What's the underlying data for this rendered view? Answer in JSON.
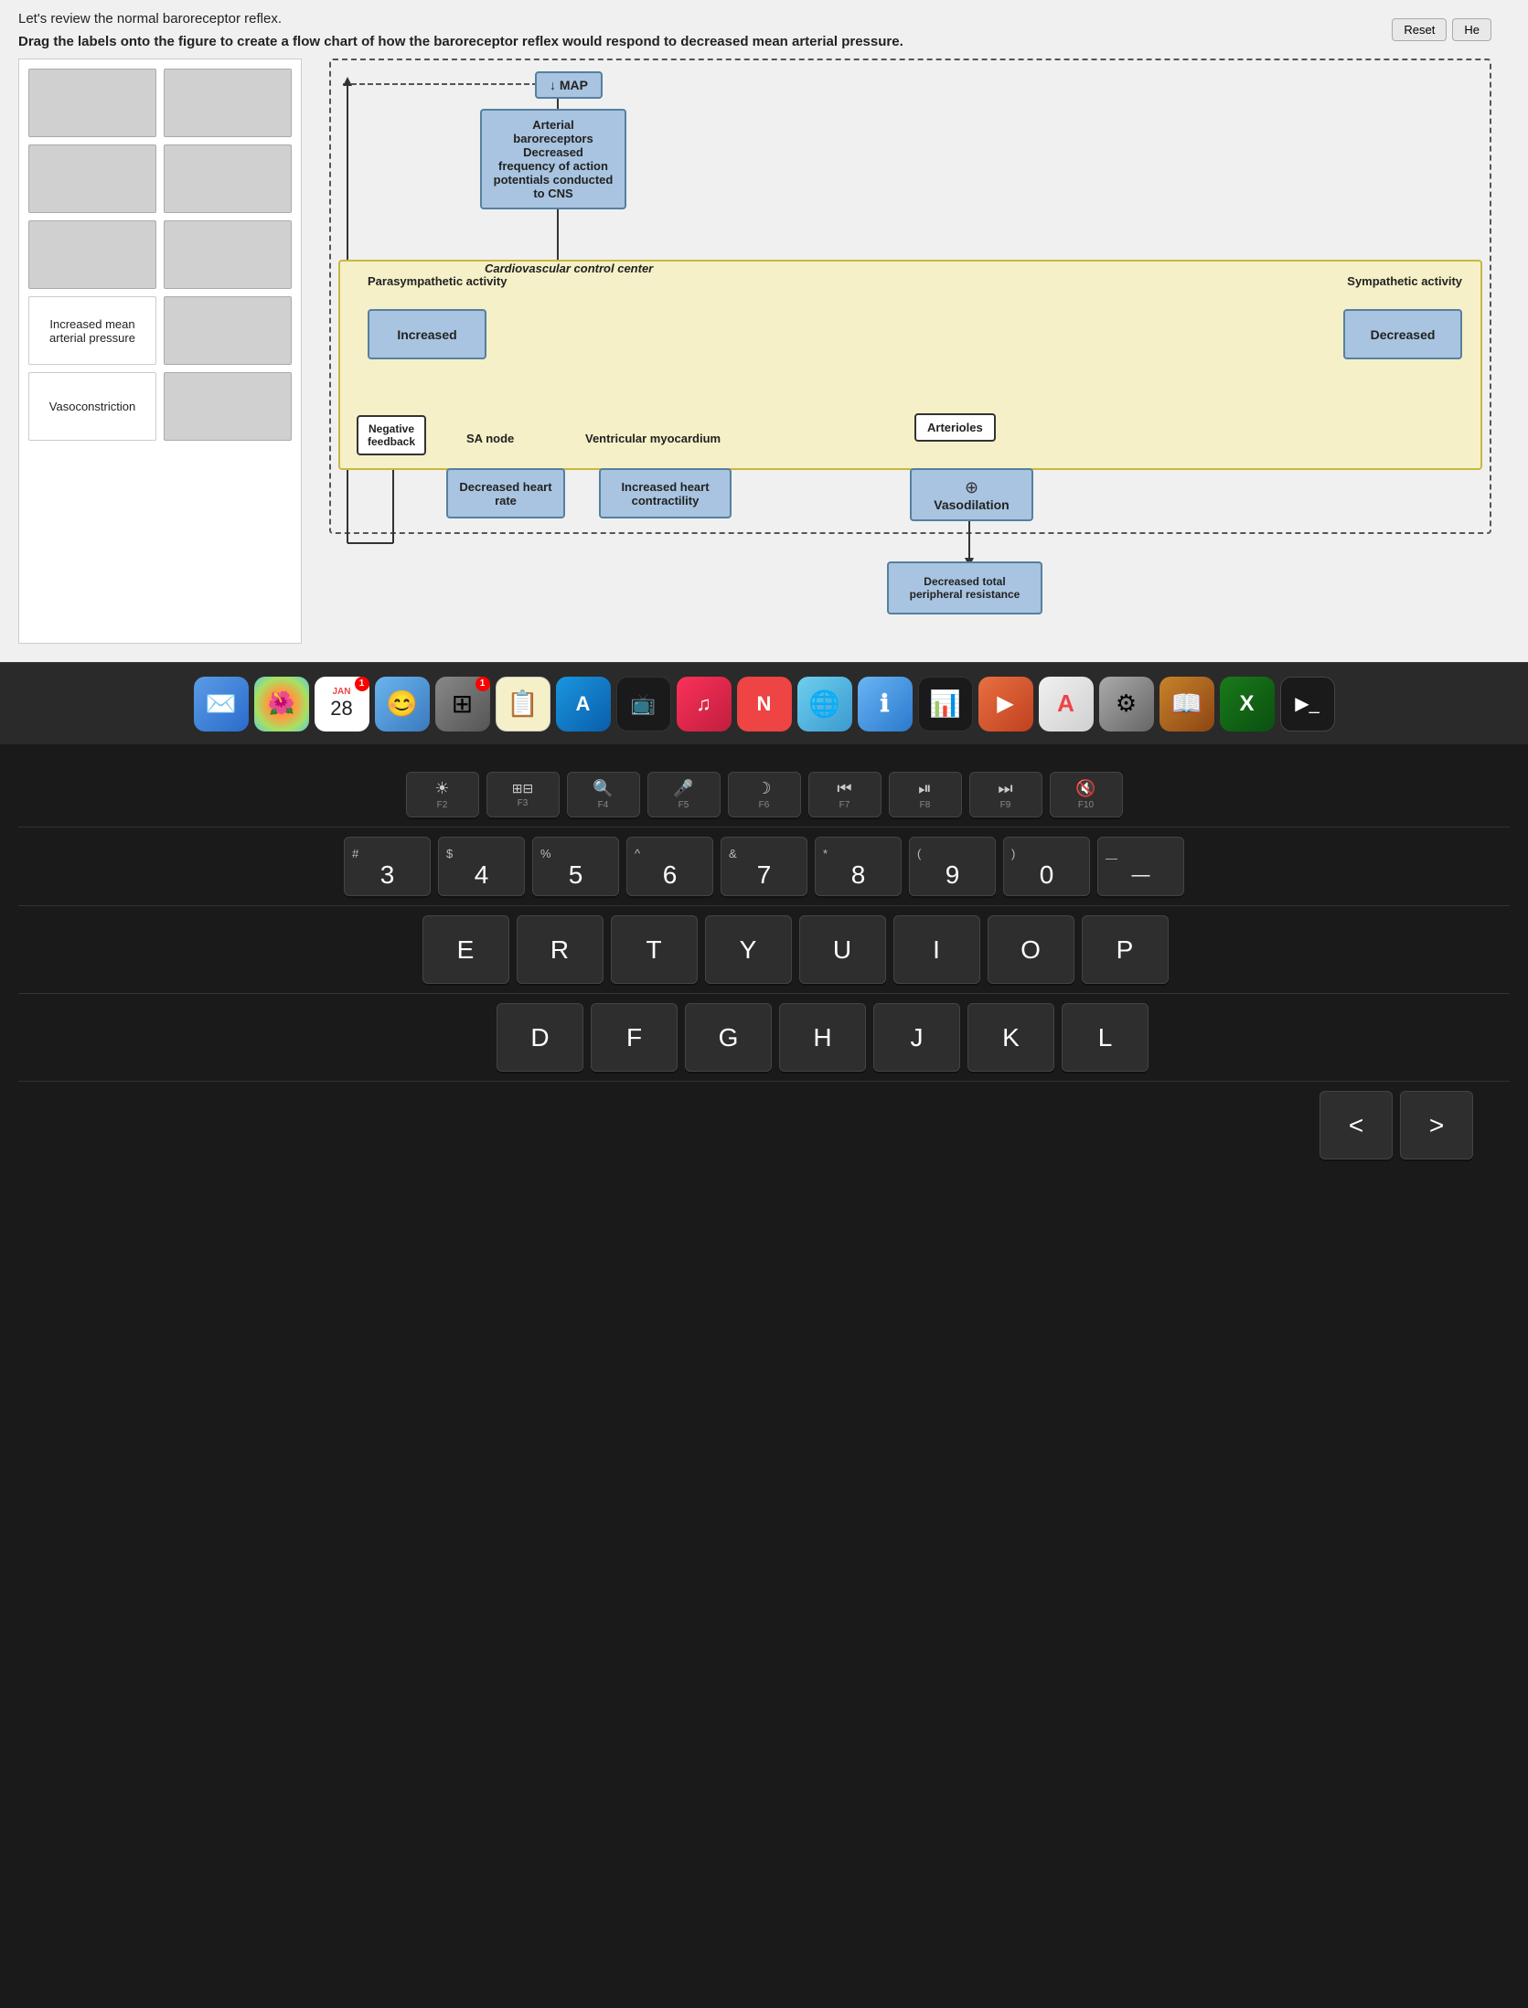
{
  "page": {
    "instruction1": "Let's review the normal baroreceptor reflex.",
    "instruction2": "Drag the labels onto the figure to create a flow chart of how the baroreceptor reflex would respond to decreased mean arterial pressure.",
    "reset_label": "Reset",
    "help_label": "He"
  },
  "flowchart": {
    "map_label": "↓ MAP",
    "arterial_box": "Arterial baroreceptors\nDecreased\nfrequency of action\npotentials conducted\nto CNS",
    "cardio_label": "Cardiovascular control center",
    "parasympathetic_label": "Parasympathetic activity",
    "sympathetic_label": "Sympathetic activity",
    "para_increased": "Increased",
    "symp_decreased": "Decreased",
    "neg_feedback": "Negative\nfeedback",
    "sa_node": "SA node",
    "ventricular": "Ventricular myocardium",
    "arterioles": "Arterioles",
    "dec_hr": "Decreased heart\nrate",
    "inc_contract": "Increased heart\ncontractility",
    "vasodilation_plus": "+",
    "vasodilation": "Vasodilation",
    "dec_tpr": "Decreased total\nperipheral resistance"
  },
  "label_panel": {
    "increased_map": "Increased mean\narterial pressure",
    "vasoconstriction": "Vasoconstriction"
  },
  "dock": {
    "icons": [
      {
        "name": "mail",
        "symbol": "✉",
        "color": "#3b82f6",
        "badge": null
      },
      {
        "name": "photos",
        "symbol": "🌸",
        "color": "#1a1a1a",
        "badge": null
      },
      {
        "name": "calendar",
        "symbol": "28",
        "color": "#fff",
        "badge": "1"
      },
      {
        "name": "finder",
        "symbol": "😊",
        "color": "#1a1a1a",
        "badge": null
      },
      {
        "name": "launchpad",
        "symbol": "⊞",
        "color": "#e44",
        "badge": "1"
      },
      {
        "name": "notes",
        "symbol": "📋",
        "color": "#f5f0c8",
        "badge": null
      },
      {
        "name": "appstore",
        "symbol": "A",
        "color": "#1a6bbf",
        "badge": null
      },
      {
        "name": "appletv",
        "symbol": "📺",
        "color": "#1a1a1a",
        "badge": null
      },
      {
        "name": "music",
        "symbol": "♫",
        "color": "#e44",
        "badge": null
      },
      {
        "name": "news",
        "symbol": "N",
        "color": "#e44",
        "badge": null
      },
      {
        "name": "safari",
        "symbol": "🌐",
        "color": "#1a1a1a",
        "badge": null
      },
      {
        "name": "info",
        "symbol": "ℹ",
        "color": "#5599ee",
        "badge": null
      },
      {
        "name": "stocks",
        "symbol": "📈",
        "color": "#1a1a1a",
        "badge": null
      },
      {
        "name": "keynote",
        "symbol": "▶",
        "color": "#e87040",
        "badge": null
      },
      {
        "name": "texteditor",
        "symbol": "A",
        "color": "#e44",
        "badge": null
      },
      {
        "name": "system",
        "symbol": "⚙",
        "color": "#888",
        "badge": null
      },
      {
        "name": "books",
        "symbol": "📖",
        "color": "#8B4513",
        "badge": null
      },
      {
        "name": "excel",
        "symbol": "X",
        "color": "#1a7a1a",
        "badge": null
      },
      {
        "name": "terminal",
        "symbol": "▶",
        "color": "#1a1a1a",
        "badge": null
      }
    ]
  },
  "keyboard": {
    "fn_row": [
      {
        "symbol": "☀",
        "label": "F2"
      },
      {
        "symbol": "⊞⊟",
        "label": "F3"
      },
      {
        "symbol": "🔍",
        "label": "F4"
      },
      {
        "symbol": "🎤",
        "label": "F5"
      },
      {
        "symbol": "☽",
        "label": "F6"
      },
      {
        "symbol": "⏮",
        "label": "F7"
      },
      {
        "symbol": "⏯",
        "label": "F8"
      },
      {
        "symbol": "⏭",
        "label": "F9"
      },
      {
        "symbol": "🔇",
        "label": "F10"
      }
    ],
    "num_row": [
      {
        "top": "#",
        "main": "3"
      },
      {
        "top": "$",
        "main": "4"
      },
      {
        "top": "%",
        "main": "5"
      },
      {
        "top": "^",
        "main": "6"
      },
      {
        "top": "&",
        "main": "7"
      },
      {
        "top": "*",
        "main": "8"
      },
      {
        "top": "(",
        "main": "9"
      },
      {
        "top": ")",
        "main": "0"
      },
      {
        "top": "—",
        "main": "—"
      }
    ],
    "letter_row1": [
      "E",
      "R",
      "T",
      "Y",
      "U",
      "I",
      "O",
      "P"
    ],
    "letter_row2": [
      "D",
      "F",
      "G",
      "H",
      "J",
      "K",
      "L"
    ],
    "letter_row3": [
      "<",
      ">"
    ]
  }
}
